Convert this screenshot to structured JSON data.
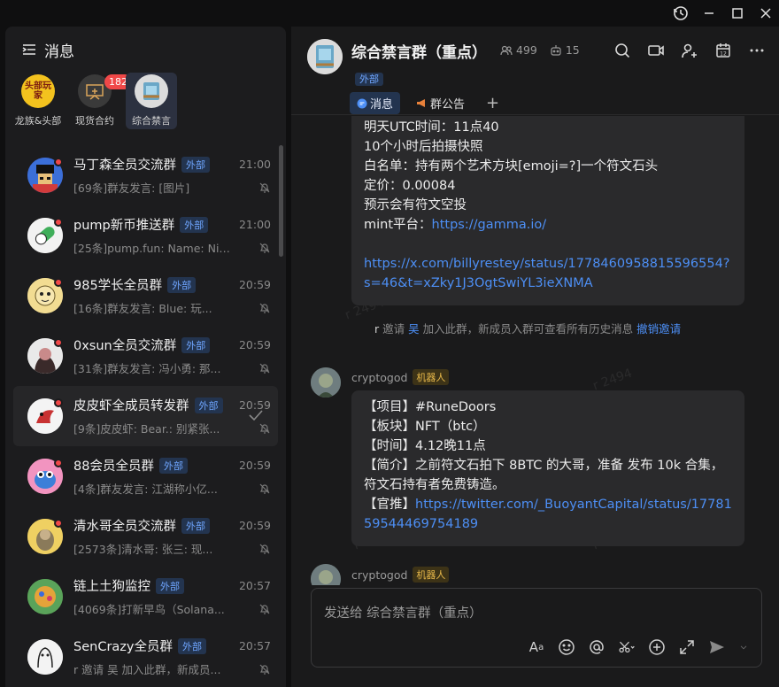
{
  "window": {
    "restore_icon": "history-icon",
    "min_icon": "minimize-icon",
    "max_icon": "maximize-icon",
    "close_icon": "close-icon"
  },
  "sidebar": {
    "title": "消息",
    "pinned": [
      {
        "label": "龙族&头部",
        "avatar_text": "头部玩家",
        "badge": ""
      },
      {
        "label": "现货合约",
        "avatar_text": "",
        "badge": "182"
      },
      {
        "label": "综合禁言",
        "avatar_text": "",
        "badge": ""
      }
    ],
    "conversations": [
      {
        "name": "马丁森全员交流群",
        "tag": "外部",
        "time": "21:00",
        "preview": "[69条]群友发言: [图片]"
      },
      {
        "name": "pump新币推送群",
        "tag": "外部",
        "time": "21:00",
        "preview": "[25条]pump.fun: Name: Nik..."
      },
      {
        "name": "985学长全员群",
        "tag": "外部",
        "time": "20:59",
        "preview": "[16条]群友发言: Blue:  玩..."
      },
      {
        "name": "0xsun全员交流群",
        "tag": "外部",
        "time": "20:59",
        "preview": "[31条]群友发言: 冯小勇: 那..."
      },
      {
        "name": "皮皮虾全成员转发群",
        "tag": "外部",
        "time": "20:59",
        "preview": "[9条]皮皮虾: Bear.:  别紧张..."
      },
      {
        "name": "88会员全员群",
        "tag": "外部",
        "time": "20:59",
        "preview": "[4条]群友发言: 江湖称小亿..."
      },
      {
        "name": "清水哥全员交流群",
        "tag": "外部",
        "time": "20:59",
        "preview": "[2573条]清水哥: 张三:  现..."
      },
      {
        "name": "链上土狗监控",
        "tag": "外部",
        "time": "20:57",
        "preview": "[4069条]打新早鸟（Solana..."
      },
      {
        "name": "SenCrazy全员群",
        "tag": "外部",
        "time": "20:57",
        "preview": "r 邀请 吴 加入此群，新成员..."
      }
    ]
  },
  "header": {
    "title": "综合禁言群（重点）",
    "members": "499",
    "bots": "15",
    "tag": "外部",
    "tabs": [
      "消息",
      "群公告"
    ]
  },
  "messages": {
    "bubble1": {
      "lines": [
        "明天UTC时间：11点40",
        "10个小时后拍摄快照",
        "白名单：持有两个艺术方块[emoji=?]一个符文石头",
        "定价：0.00084",
        "预示会有符文空投"
      ],
      "mint_label": "mint平台：",
      "mint_link": "https://gamma.io/",
      "link2": "https://x.com/billyrestey/status/1778460958815596554?s=46&t=xZky1J3OgtSwiYL3ieXNMA"
    },
    "system": {
      "actor": "r",
      "verb": "邀请",
      "target": "吴",
      "rest": "加入此群，新成员入群可查看所有历史消息",
      "action": "撤销邀请"
    },
    "sender": "cryptogod",
    "bot_tag": "机器人",
    "bubble2": {
      "l1": "【项目】#RuneDoors",
      "l2": "【板块】NFT（btc）",
      "l3": "【时间】4.12晚11点",
      "l4": "【简介】之前符文石拍下 8BTC 的大哥，准备 发布 10k 合集，符文石持有者免费铸造。",
      "l5_label": "【官推】",
      "l5_link": "https://twitter.com/_BuoyantCapital/status/1778159544469754189"
    },
    "watermark": "r 2494"
  },
  "composer": {
    "placeholder": "发送给 综合禁言群（重点）"
  }
}
